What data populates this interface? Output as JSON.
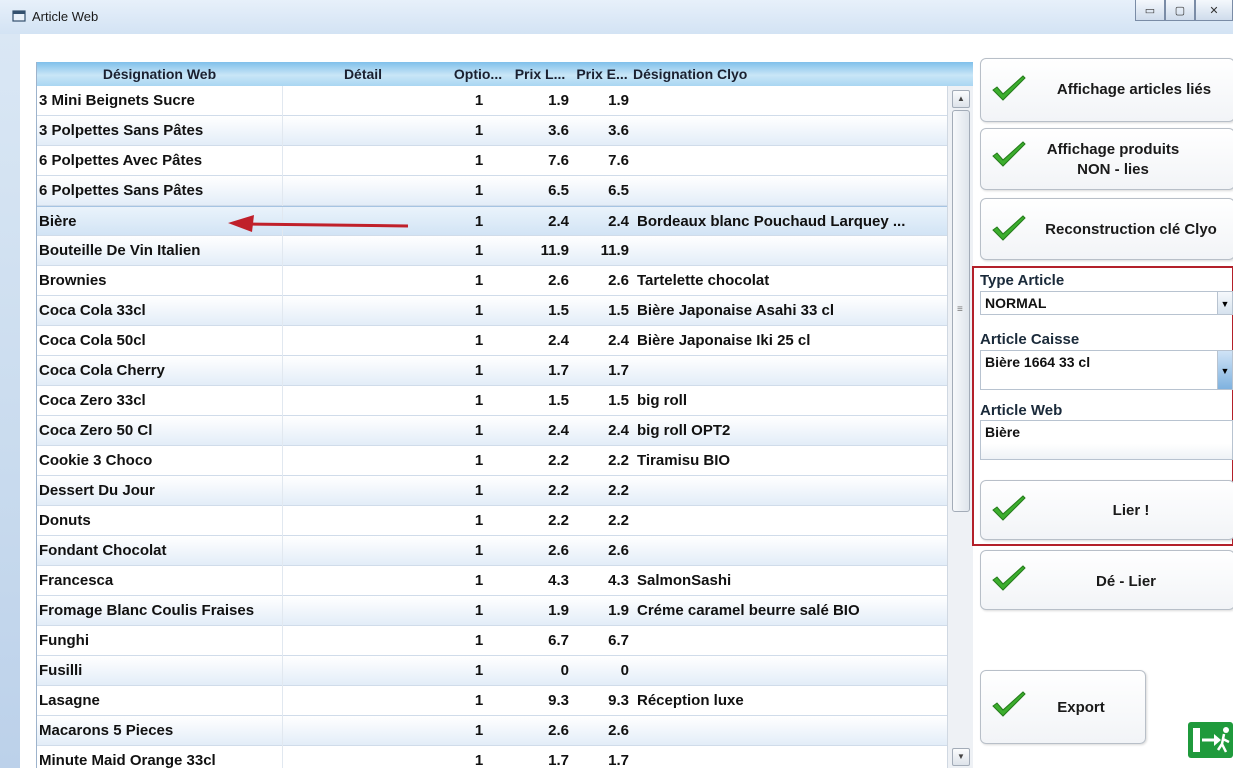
{
  "window": {
    "title": "Article Web",
    "controls": {
      "minimize": "▭",
      "maximize": "▢",
      "close": "✕"
    }
  },
  "grid": {
    "headers": {
      "name": "Désignation Web",
      "detail": "Détail",
      "option": "Optio...",
      "prix_l": "Prix L...",
      "prix_e": "Prix E...",
      "clyo": "Désignation Clyo"
    },
    "rows": [
      {
        "name": "3 Mini Beignets Sucre",
        "opt": "1",
        "pl": "1.9",
        "pe": "1.9",
        "clyo": ""
      },
      {
        "name": "3 Polpettes Sans Pâtes",
        "opt": "1",
        "pl": "3.6",
        "pe": "3.6",
        "clyo": ""
      },
      {
        "name": "6 Polpettes Avec Pâtes",
        "opt": "1",
        "pl": "7.6",
        "pe": "7.6",
        "clyo": ""
      },
      {
        "name": "6 Polpettes Sans Pâtes",
        "opt": "1",
        "pl": "6.5",
        "pe": "6.5",
        "clyo": ""
      },
      {
        "name": "Bière",
        "opt": "1",
        "pl": "2.4",
        "pe": "2.4",
        "clyo": "Bordeaux blanc Pouchaud Larquey ..."
      },
      {
        "name": "Bouteille De Vin Italien",
        "opt": "1",
        "pl": "11.9",
        "pe": "11.9",
        "clyo": ""
      },
      {
        "name": "Brownies",
        "opt": "1",
        "pl": "2.6",
        "pe": "2.6",
        "clyo": "Tartelette chocolat"
      },
      {
        "name": "Coca Cola 33cl",
        "opt": "1",
        "pl": "1.5",
        "pe": "1.5",
        "clyo": "Bière Japonaise Asahi 33 cl"
      },
      {
        "name": "Coca Cola 50cl",
        "opt": "1",
        "pl": "2.4",
        "pe": "2.4",
        "clyo": "Bière Japonaise Iki 25 cl"
      },
      {
        "name": "Coca Cola Cherry",
        "opt": "1",
        "pl": "1.7",
        "pe": "1.7",
        "clyo": ""
      },
      {
        "name": "Coca Zero 33cl",
        "opt": "1",
        "pl": "1.5",
        "pe": "1.5",
        "clyo": "big roll"
      },
      {
        "name": "Coca Zero 50 Cl",
        "opt": "1",
        "pl": "2.4",
        "pe": "2.4",
        "clyo": "big roll OPT2"
      },
      {
        "name": "Cookie 3 Choco",
        "opt": "1",
        "pl": "2.2",
        "pe": "2.2",
        "clyo": "Tiramisu BIO"
      },
      {
        "name": "Dessert Du Jour",
        "opt": "1",
        "pl": "2.2",
        "pe": "2.2",
        "clyo": ""
      },
      {
        "name": "Donuts",
        "opt": "1",
        "pl": "2.2",
        "pe": "2.2",
        "clyo": ""
      },
      {
        "name": "Fondant Chocolat",
        "opt": "1",
        "pl": "2.6",
        "pe": "2.6",
        "clyo": ""
      },
      {
        "name": "Francesca",
        "opt": "1",
        "pl": "4.3",
        "pe": "4.3",
        "clyo": "SalmonSashi"
      },
      {
        "name": "Fromage Blanc Coulis Fraises",
        "opt": "1",
        "pl": "1.9",
        "pe": "1.9",
        "clyo": "Créme caramel beurre salé BIO"
      },
      {
        "name": "Funghi",
        "opt": "1",
        "pl": "6.7",
        "pe": "6.7",
        "clyo": ""
      },
      {
        "name": "Fusilli",
        "opt": "1",
        "pl": "0",
        "pe": "0",
        "clyo": ""
      },
      {
        "name": "Lasagne",
        "opt": "1",
        "pl": "9.3",
        "pe": "9.3",
        "clyo": "Réception luxe"
      },
      {
        "name": "Macarons 5 Pieces",
        "opt": "1",
        "pl": "2.6",
        "pe": "2.6",
        "clyo": ""
      },
      {
        "name": "Minute Maid Orange 33cl",
        "opt": "1",
        "pl": "1.7",
        "pe": "1.7",
        "clyo": ""
      }
    ],
    "selected_index": 4
  },
  "panel": {
    "btn_linked": "Affichage articles liés",
    "btn_unlinked_line1": "Affichage produits",
    "btn_unlinked_line2": "NON - lies",
    "btn_rebuild": "Reconstruction clé Clyo",
    "type_label": "Type Article",
    "type_value": "NORMAL",
    "caisse_label": "Article Caisse",
    "caisse_value": "Bière 1664 33 cl",
    "web_label": "Article Web",
    "web_value": "Bière",
    "btn_link": "Lier !",
    "btn_unlink": "Dé - Lier",
    "btn_export": "Export"
  },
  "colors": {
    "check": "#3cae2e",
    "annotation_arrow": "#c0202a",
    "highlight_box": "#b3202a",
    "exit_icon": "#1f9a3c"
  }
}
